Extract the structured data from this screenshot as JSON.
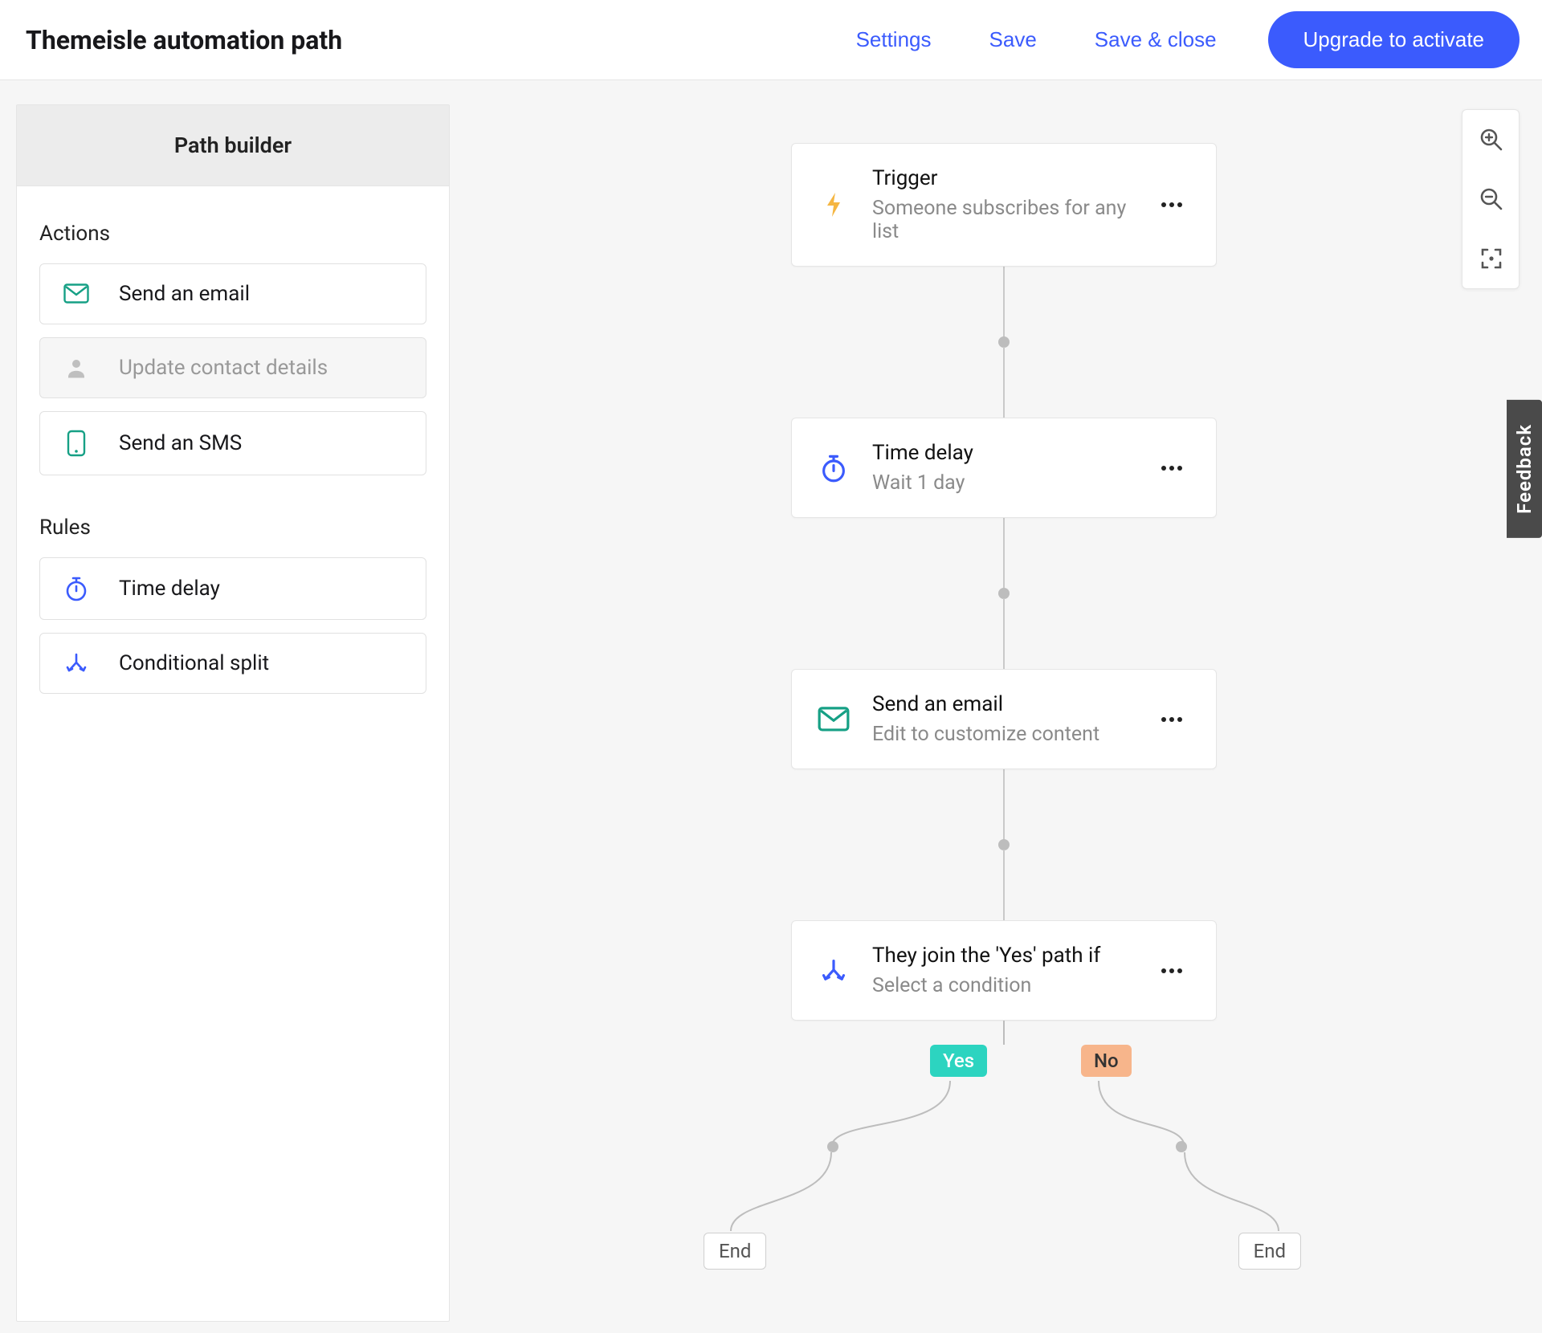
{
  "header": {
    "title": "Themeisle automation path",
    "settings": "Settings",
    "save": "Save",
    "save_close": "Save & close",
    "upgrade": "Upgrade to activate"
  },
  "sidebar": {
    "title": "Path builder",
    "actions_label": "Actions",
    "rules_label": "Rules",
    "actions": {
      "email": "Send an email",
      "update": "Update contact details",
      "sms": "Send an SMS"
    },
    "rules": {
      "delay": "Time delay",
      "split": "Conditional split"
    }
  },
  "flow": {
    "trigger": {
      "title": "Trigger",
      "sub": "Someone subscribes for any list"
    },
    "delay": {
      "title": "Time delay",
      "sub": "Wait 1 day"
    },
    "email": {
      "title": "Send an email",
      "sub": "Edit to customize content"
    },
    "split": {
      "title": "They join the 'Yes' path if",
      "sub": "Select a condition"
    },
    "yes": "Yes",
    "no": "No",
    "end": "End"
  },
  "feedback": "Feedback"
}
